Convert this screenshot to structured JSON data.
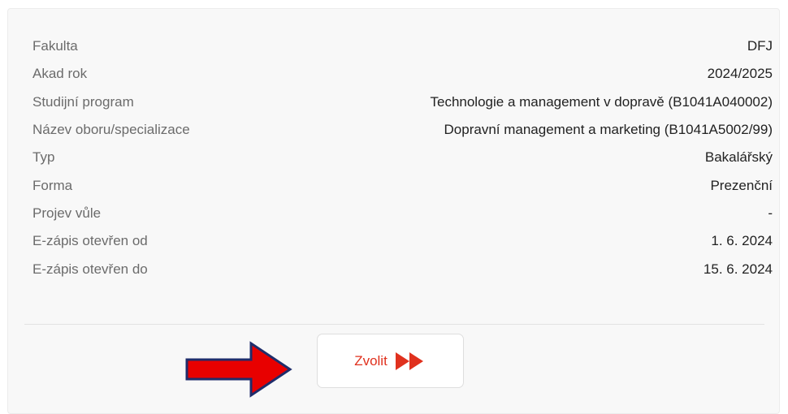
{
  "details": {
    "rows": [
      {
        "label": "Fakulta",
        "value": "DFJ"
      },
      {
        "label": "Akad rok",
        "value": "2024/2025"
      },
      {
        "label": "Studijní program",
        "value": "Technologie a management v dopravě (B1041A040002)"
      },
      {
        "label": "Název oboru/specializace",
        "value": "Dopravní management a marketing (B1041A5002/99)"
      },
      {
        "label": "Typ",
        "value": "Bakalářský"
      },
      {
        "label": "Forma",
        "value": "Prezenční"
      },
      {
        "label": "Projev vůle",
        "value": "-"
      },
      {
        "label": "E-zápis otevřen od",
        "value": "1. 6. 2024"
      },
      {
        "label": "E-zápis otevřen do",
        "value": "15. 6. 2024"
      }
    ]
  },
  "action": {
    "select_label": "Zvolit",
    "icon": "double-play-icon",
    "accent_color": "#e0311e"
  },
  "annotation": {
    "icon": "red-arrow-icon",
    "color": "#e80000"
  }
}
